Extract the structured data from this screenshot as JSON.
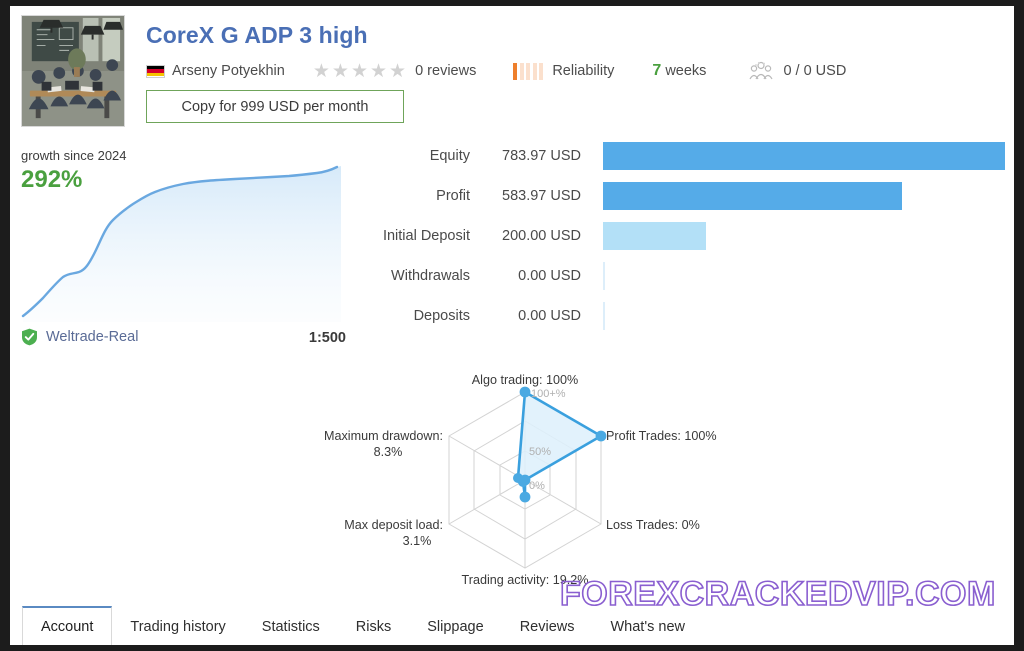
{
  "header": {
    "title": "CoreX G ADP 3 high",
    "thumbnail_alt": "office-meeting-photo",
    "author": "Arseny Potyekhin",
    "flag": "germany-flag",
    "stars_filled": 0,
    "stars_total": 5,
    "reviews": "0 reviews",
    "reliability": {
      "label": "Reliability",
      "filled_bars": 1,
      "total_bars": 5,
      "accent": "#ee7f2c"
    },
    "age": {
      "number": "7",
      "unit": "weeks",
      "color": "#4aa03f"
    },
    "subscribers": "0 / 0 USD",
    "copy_button": "Copy for 999 USD per month",
    "title_color": "#4a6fb5"
  },
  "growth": {
    "label": "growth since 2024",
    "value": "292%",
    "value_color": "#4aa03f",
    "line_color": "#6aa8e0"
  },
  "account": {
    "broker": "Weltrade-Real",
    "verified": true,
    "leverage": "1:500"
  },
  "stats": [
    {
      "label": "Equity",
      "value": "783.97 USD",
      "pct": 100.0,
      "tone": "full"
    },
    {
      "label": "Profit",
      "value": "583.97 USD",
      "pct": 74.5,
      "tone": "full"
    },
    {
      "label": "Initial Deposit",
      "value": "200.00 USD",
      "pct": 25.5,
      "tone": "light"
    },
    {
      "label": "Withdrawals",
      "value": "0.00 USD",
      "pct": 0.0,
      "tone": "zero"
    },
    {
      "label": "Deposits",
      "value": "0.00 USD",
      "pct": 0.0,
      "tone": "zero"
    }
  ],
  "chart_data": [
    {
      "type": "area",
      "title": "growth since 2024",
      "xlabel": "",
      "ylabel": "growth %",
      "ylim": [
        0,
        292
      ],
      "grid": false,
      "legend": "none",
      "x": [
        0,
        5,
        10,
        14,
        18,
        22,
        26,
        30,
        34,
        38,
        42,
        48,
        54,
        60,
        68,
        76,
        84,
        92,
        100
      ],
      "values": [
        4,
        12,
        22,
        36,
        45,
        48,
        56,
        72,
        95,
        118,
        150,
        182,
        205,
        228,
        240,
        248,
        255,
        268,
        292
      ],
      "series_name": "Growth",
      "final_value_label": "292%"
    },
    {
      "type": "bar",
      "title": "Account balance breakdown",
      "orientation": "horizontal",
      "categories": [
        "Equity",
        "Profit",
        "Initial Deposit",
        "Withdrawals",
        "Deposits"
      ],
      "values": [
        783.97,
        583.97,
        200.0,
        0.0,
        0.0
      ],
      "value_labels": [
        "783.97 USD",
        "583.97 USD",
        "200.00 USD",
        "0.00 USD",
        "0.00 USD"
      ],
      "unit": "USD",
      "xlim": [
        0,
        783.97
      ],
      "grid": false,
      "legend": "none",
      "colors": [
        "#55abe8",
        "#55abe8",
        "#b3e0f7",
        "#ddeefa",
        "#ddeefa"
      ]
    },
    {
      "type": "radar",
      "title": "",
      "grid": true,
      "legend": "none",
      "rings": [
        "0%",
        "50%",
        "100+%"
      ],
      "rlim": [
        0,
        100
      ],
      "categories": [
        "Algo trading",
        "Profit Trades",
        "Loss Trades",
        "Trading activity",
        "Max deposit load",
        "Maximum drawdown"
      ],
      "values": [
        100,
        100,
        0,
        19.2,
        3.1,
        8.3
      ],
      "axis_labels": [
        "Algo trading: 100%",
        "Profit Trades: 100%",
        "Loss Trades: 0%",
        "Trading activity: 19.2%",
        "Max deposit load: 3.1%",
        "Maximum drawdown: 8.3%"
      ],
      "series_color": "#3aa0de",
      "fill_color": "#ddf0fb"
    }
  ],
  "radar": {
    "ring_labels": [
      "0%",
      "50%",
      "100+%"
    ],
    "axes": [
      {
        "name": "Algo trading",
        "label_line1": "Algo trading: 100%",
        "label_line2": ""
      },
      {
        "name": "Profit Trades",
        "label_line1": "Profit Trades: 100%",
        "label_line2": ""
      },
      {
        "name": "Loss Trades",
        "label_line1": "Loss Trades: 0%",
        "label_line2": ""
      },
      {
        "name": "Trading activity",
        "label_line1": "Trading activity: 19.2%",
        "label_line2": ""
      },
      {
        "name": "Max deposit load",
        "label_line1": "Max deposit load:",
        "label_line2": "3.1%"
      },
      {
        "name": "Maximum drawdown",
        "label_line1": "Maximum drawdown:",
        "label_line2": "8.3%"
      }
    ]
  },
  "watermark": "FOREXCRACKEDVIP.COM",
  "tabs": [
    {
      "label": "Account",
      "active": true
    },
    {
      "label": "Trading history",
      "active": false
    },
    {
      "label": "Statistics",
      "active": false
    },
    {
      "label": "Risks",
      "active": false
    },
    {
      "label": "Slippage",
      "active": false
    },
    {
      "label": "Reviews",
      "active": false
    },
    {
      "label": "What's new",
      "active": false
    }
  ]
}
